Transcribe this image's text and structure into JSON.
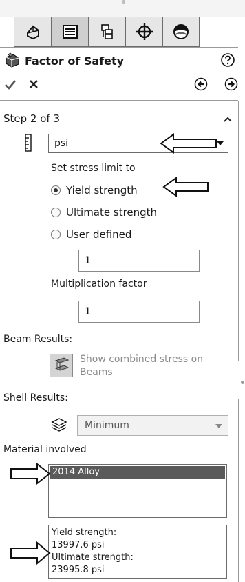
{
  "tabs": [
    {
      "name": "featuremanager",
      "icon": "tree-icon"
    },
    {
      "name": "propertymanager",
      "icon": "property-list-icon"
    },
    {
      "name": "configurationmanager",
      "icon": "configuration-icon"
    },
    {
      "name": "dimxpertmanager",
      "icon": "crosshair-icon"
    },
    {
      "name": "displaymanager",
      "icon": "appearance-sphere-icon"
    }
  ],
  "header": {
    "title": "Factor of Safety",
    "help_icon": "help-icon"
  },
  "actions": {
    "ok_icon": "checkmark-icon",
    "cancel_icon": "close-icon",
    "back_icon": "back-arrow-icon",
    "next_icon": "next-arrow-icon"
  },
  "step": {
    "label": "Step 2 of 3",
    "units_value": "psi",
    "stress_limit_label": "Set stress limit to",
    "options": [
      {
        "label": "Yield strength",
        "checked": true
      },
      {
        "label": "Ultimate strength",
        "checked": false
      },
      {
        "label": "User defined",
        "checked": false
      }
    ],
    "user_defined_value": "1",
    "multiplication_label": "Multiplication factor",
    "multiplication_value": "1"
  },
  "beam": {
    "label": "Beam Results:",
    "combined_stress_text": "Show combined stress on Beams"
  },
  "shell": {
    "label": "Shell Results:",
    "value": "Minimum"
  },
  "material": {
    "label": "Material involved",
    "items": [
      "2014 Alloy"
    ],
    "properties": [
      "Yield strength:",
      "13997.6 psi",
      "Ultimate strength:",
      "23995.8 psi"
    ]
  },
  "colors": {
    "selection": "#5a5a5a",
    "border": "#6c6c6c"
  }
}
